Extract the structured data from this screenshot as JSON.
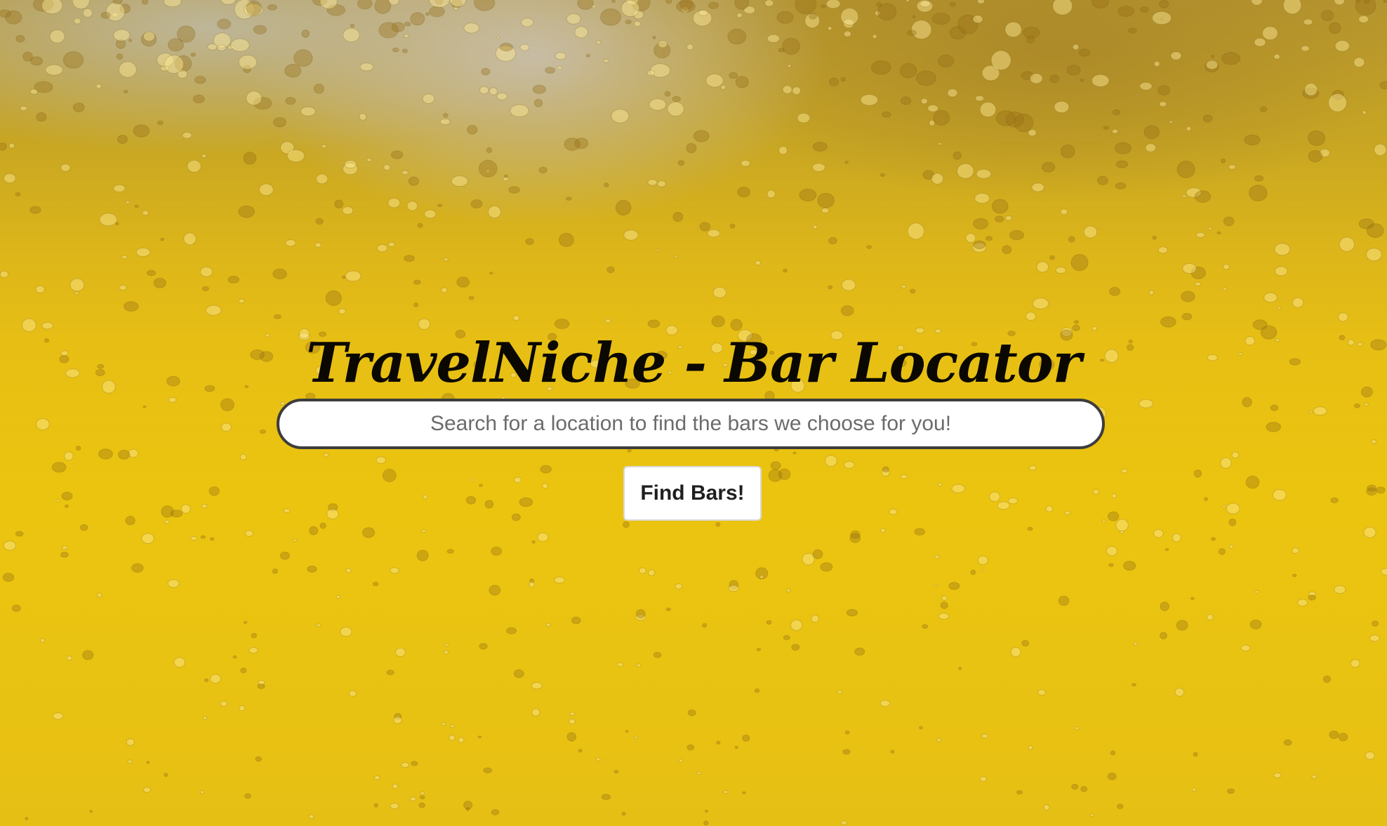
{
  "page": {
    "title": "TravelNiche - Bar Locator",
    "background_theme": "beer-bubbles",
    "colors": {
      "background_primary": "#e7bf14",
      "background_foam": "#c8bea8",
      "title_text": "#0a0800",
      "input_border": "#3d3d3d",
      "button_background": "#ffffff"
    }
  },
  "search": {
    "placeholder": "Search for a location to find the bars we choose for you!",
    "value": ""
  },
  "actions": {
    "find_label": "Find Bars!"
  }
}
